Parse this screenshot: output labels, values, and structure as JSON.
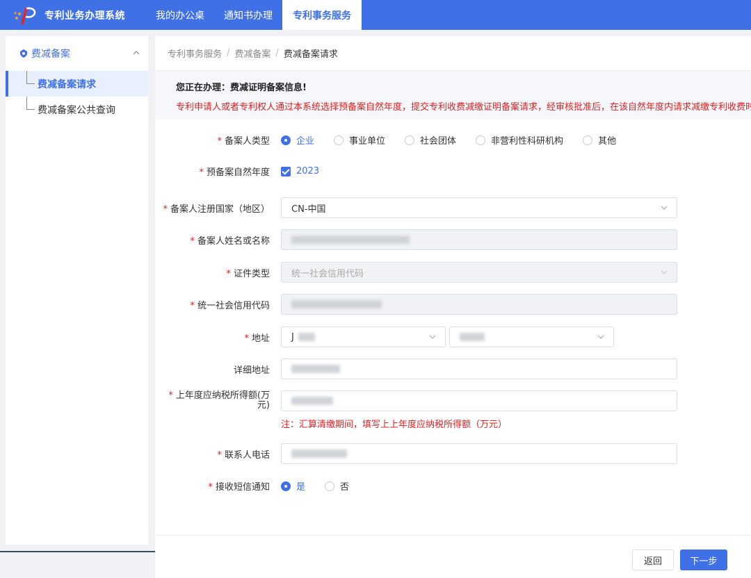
{
  "app": {
    "title": "专利业务办理系统"
  },
  "nav": {
    "items": [
      "我的办公桌",
      "通知书办理",
      "专利事务服务"
    ]
  },
  "sidebar": {
    "group_label": "费减备案",
    "items": [
      "费减备案请求",
      "费减备案公共查询"
    ]
  },
  "breadcrumb": {
    "items": [
      "专利事务服务",
      "费减备案",
      "费减备案请求"
    ]
  },
  "notice": {
    "title": "您正在办理：费减证明备案信息!",
    "text": "专利申请人或者专利权人通过本系统选择预备案自然年度，提交专利收费减缴证明备案请求，经审核批准后，在该自然年度内请求减缴专利收费时"
  },
  "form": {
    "filer_type": {
      "label": "备案人类型",
      "options": [
        "企业",
        "事业单位",
        "社会团体",
        "非营利性科研机构",
        "其他"
      ],
      "selected": "企业"
    },
    "year": {
      "label": "预备案自然年度",
      "value": "2023"
    },
    "country": {
      "label": "备案人注册国家（地区）",
      "value": "CN-中国"
    },
    "name": {
      "label": "备案人姓名或名称"
    },
    "id_type": {
      "label": "证件类型",
      "value": "统一社会信用代码"
    },
    "credit_code": {
      "label": "统一社会信用代码"
    },
    "address": {
      "label": "地址",
      "value1": "J"
    },
    "detail_address": {
      "label": "详细地址"
    },
    "income": {
      "label_line1": "上年度应纳税所得额(万",
      "label_line2": "元)",
      "note": "注：汇算清缴期间，填写上上年度应纳税所得额（万元）"
    },
    "phone": {
      "label": "联系人电话"
    },
    "sms": {
      "label": "接收短信通知",
      "options": [
        "是",
        "否"
      ],
      "selected": "是"
    }
  },
  "buttons": {
    "back": "返回",
    "next": "下一步"
  },
  "colors": {
    "primary": "#3f70e6",
    "danger": "#e02020"
  }
}
